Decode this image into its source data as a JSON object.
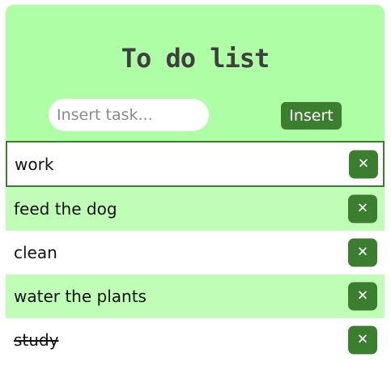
{
  "header": {
    "title": "To do list"
  },
  "form": {
    "placeholder": "Insert task...",
    "value": "",
    "insert_label": "Insert"
  },
  "tasks": [
    {
      "text": "work",
      "done": false,
      "selected": true
    },
    {
      "text": "feed the dog",
      "done": false,
      "selected": false
    },
    {
      "text": "clean",
      "done": false,
      "selected": false
    },
    {
      "text": "water the plants",
      "done": false,
      "selected": false
    },
    {
      "text": "study",
      "done": true,
      "selected": false
    }
  ],
  "delete_glyph": "✕",
  "delete_icon": "close-icon",
  "colors": {
    "header_bg": "#adfea4",
    "row_alt_bg": "#c0fdb7",
    "accent": "#3b7e2f",
    "title_text": "#3f3f3f"
  }
}
